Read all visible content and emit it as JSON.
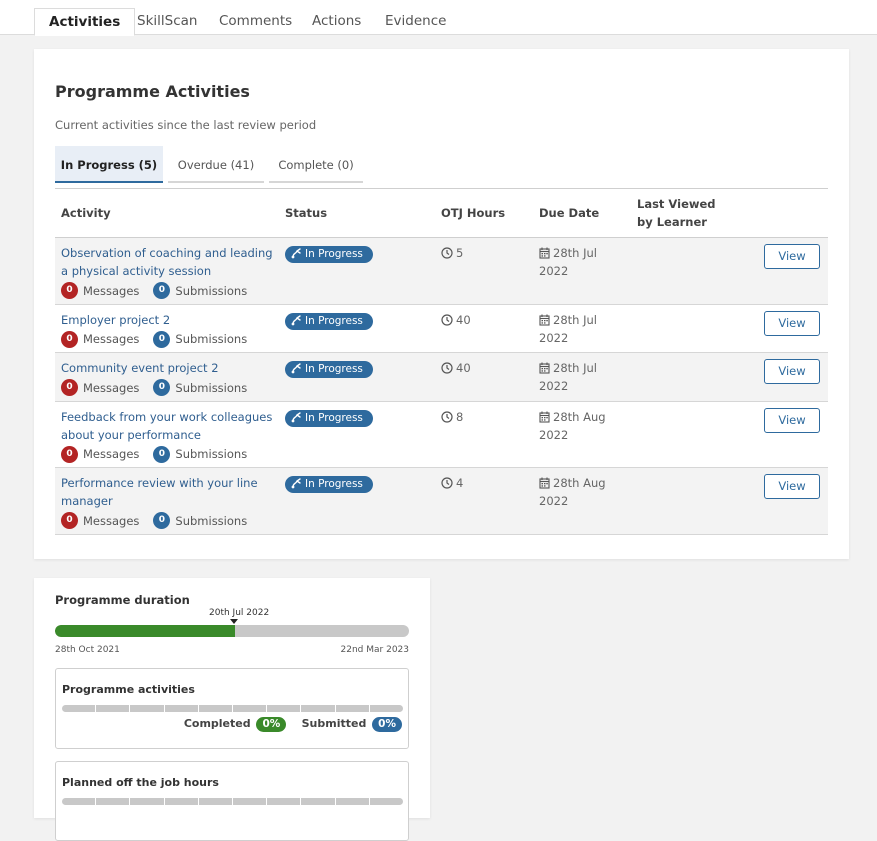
{
  "top_tabs": [
    "Activities",
    "SkillScan",
    "Comments",
    "Actions",
    "Evidence"
  ],
  "programme_activities": {
    "title": "Programme Activities",
    "subtitle": "Current activities since the last review period",
    "tabs": [
      "In Progress (5)",
      "Overdue (41)",
      "Complete (0)"
    ],
    "columns": {
      "activity": "Activity",
      "status": "Status",
      "otj_hours": "OTJ Hours",
      "due_date": "Due Date",
      "last_viewed_1": "Last Viewed",
      "last_viewed_2": "by Learner"
    },
    "rows": [
      {
        "title_1": "Observation of coaching and leading",
        "title_2": "a physical activity session",
        "messages": "0",
        "submissions": "0",
        "status": "In Progress",
        "hours": "5",
        "due_1": "28th Jul",
        "due_2": "2022"
      },
      {
        "title_1": "Employer project 2",
        "title_2": "",
        "messages": "0",
        "submissions": "0",
        "status": "In Progress",
        "hours": "40",
        "due_1": "28th Jul",
        "due_2": "2022"
      },
      {
        "title_1": "Community event project 2",
        "title_2": "",
        "messages": "0",
        "submissions": "0",
        "status": "In Progress",
        "hours": "40",
        "due_1": "28th Jul",
        "due_2": "2022"
      },
      {
        "title_1": "Feedback from your work colleagues",
        "title_2": "about your performance",
        "messages": "0",
        "submissions": "0",
        "status": "In Progress",
        "hours": "8",
        "due_1": "28th Aug",
        "due_2": "2022"
      },
      {
        "title_1": "Performance review with your line",
        "title_2": "manager",
        "messages": "0",
        "submissions": "0",
        "status": "In Progress",
        "hours": "4",
        "due_1": "28th Aug",
        "due_2": "2022"
      }
    ],
    "messages_label": "Messages",
    "submissions_label": "Submissions",
    "view_label": "View"
  },
  "duration": {
    "title": "Programme duration",
    "current_date": "20th Jul 2022",
    "start_date": "28th Oct 2021",
    "end_date": "22nd Mar 2023",
    "progress_fraction": 0.508,
    "activities_title": "Programme activities",
    "completed_label": "Completed",
    "completed_value": "0%",
    "submitted_label": "Submitted",
    "submitted_value": "0%",
    "hours_title": "Planned off the job hours"
  },
  "colors": {
    "accent_blue": "#2e6a9e",
    "danger_red": "#b32424",
    "progress_green": "#3a8a2a"
  }
}
